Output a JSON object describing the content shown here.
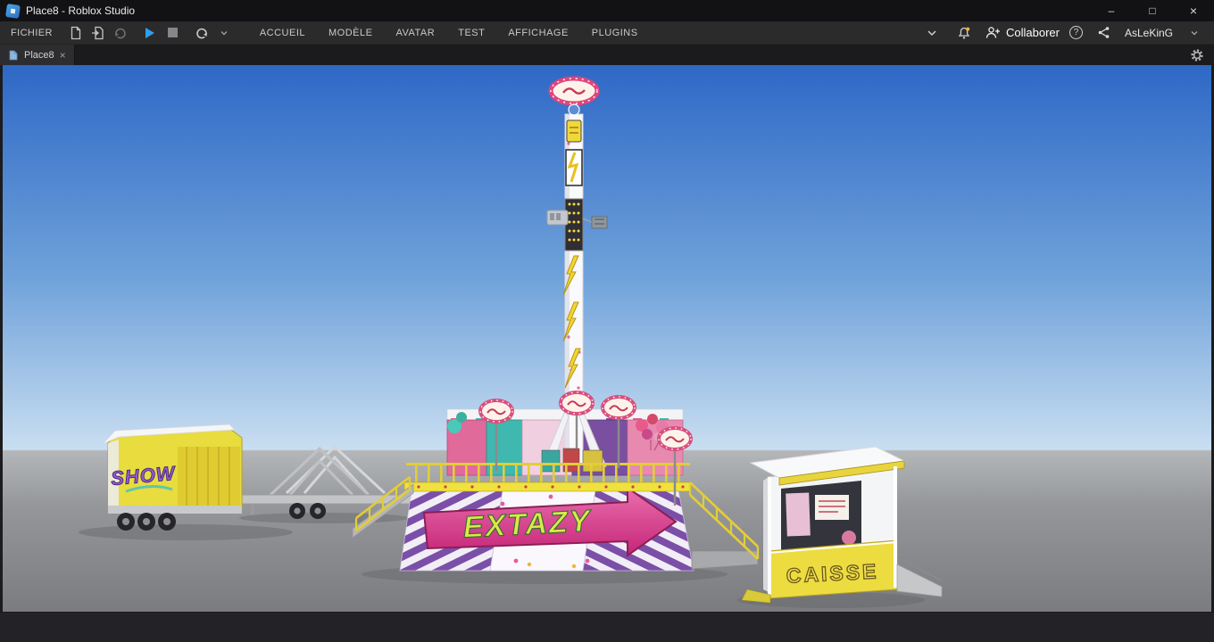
{
  "window": {
    "title": "Place8 - Roblox Studio",
    "controls": {
      "minimize": "–",
      "maximize": "□",
      "close": "×"
    }
  },
  "menubar": {
    "file_label": "FICHIER",
    "tabs": [
      "ACCUEIL",
      "MODÈLE",
      "AVATAR",
      "TEST",
      "AFFICHAGE",
      "PLUGINS"
    ],
    "collaborate_label": "Collaborer",
    "help_glyph": "?",
    "username": "AsLeKinG"
  },
  "tabbar": {
    "active_tab": "Place8",
    "close_glyph": "×"
  },
  "scene": {
    "ride_name": "EXTAZY",
    "booth_sign": "CAISSE",
    "truck_graffiti": "SHOW",
    "colors": {
      "sky_top": "#2e68c6",
      "sky_horizon": "#c9def1",
      "ground": "#8e8f91",
      "accent_pink": "#d6317f",
      "accent_yellow": "#eede3e",
      "stripe_purple": "#7b4fa8"
    }
  }
}
